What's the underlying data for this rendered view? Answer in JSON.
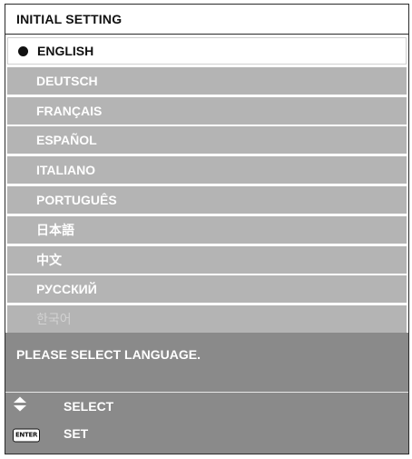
{
  "window": {
    "title": "INITIAL SETTING"
  },
  "languages": {
    "items": [
      {
        "label": "ENGLISH",
        "selected": true
      },
      {
        "label": "DEUTSCH",
        "selected": false
      },
      {
        "label": "FRANÇAIS",
        "selected": false
      },
      {
        "label": "ESPAÑOL",
        "selected": false
      },
      {
        "label": "ITALIANO",
        "selected": false
      },
      {
        "label": "PORTUGUÊS",
        "selected": false
      },
      {
        "label": "日本語",
        "selected": false
      },
      {
        "label": "中文",
        "selected": false
      },
      {
        "label": "РУССКИЙ",
        "selected": false
      },
      {
        "label": "한국어",
        "selected": false
      }
    ]
  },
  "message": {
    "text": "PLEASE SELECT LANGUAGE."
  },
  "guide": {
    "select_label": "SELECT",
    "select_icon": "up-down-arrows-icon",
    "set_label": "SET",
    "set_icon": "enter-key-icon",
    "enter_key_text": "ENTER"
  },
  "colors": {
    "panel_gray": "#8a8a8a",
    "item_gray": "#b4b4b4",
    "selected_bg": "#ffffff",
    "text_dark": "#111111",
    "text_light": "#ffffff"
  }
}
